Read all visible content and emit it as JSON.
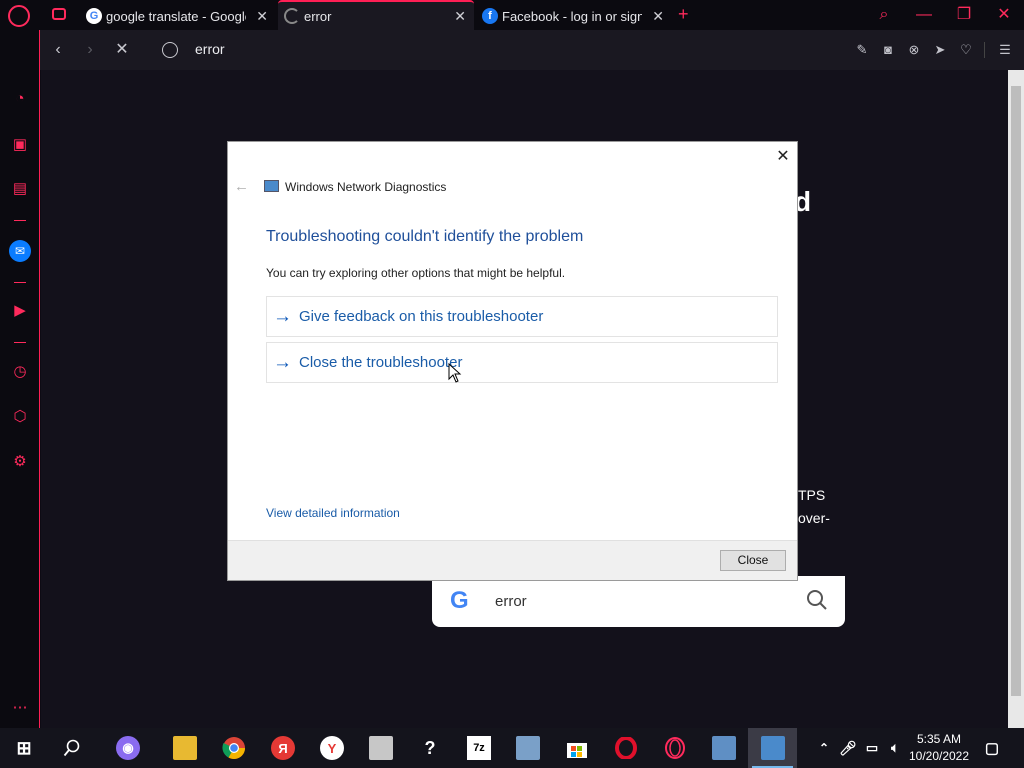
{
  "tabs": [
    {
      "title": "google translate - Google S",
      "favicon": "google-icon"
    },
    {
      "title": "error",
      "favicon": "loading-spinner-icon"
    },
    {
      "title": "Facebook - log in or sign u",
      "favicon": "facebook-icon"
    }
  ],
  "address": {
    "url": "error"
  },
  "background": {
    "heading_fragment": "d",
    "text_fragment_1": "TPS",
    "text_fragment_2": "over-"
  },
  "google_search": {
    "query": "error"
  },
  "dialog": {
    "app_title": "Windows Network Diagnostics",
    "heading": "Troubleshooting couldn't identify the problem",
    "subtext": "You can try exploring other options that might be helpful.",
    "options": [
      {
        "label": "Give feedback on this troubleshooter"
      },
      {
        "label": "Close the troubleshooter"
      }
    ],
    "details_link": "View detailed information",
    "close_button": "Close"
  },
  "taskbar": {
    "time": "5:35 AM",
    "date": "10/20/2022"
  },
  "colors": {
    "opera_accent": "#ff1f55",
    "dialog_link_blue": "#1a5ca8",
    "dialog_heading_blue": "#1f4f9a"
  }
}
